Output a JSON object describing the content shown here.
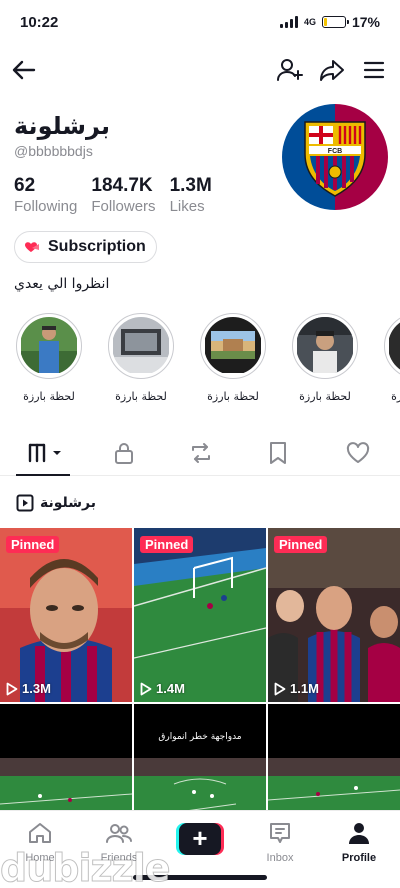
{
  "status_bar": {
    "time": "10:22",
    "network": "4G",
    "battery": "17%",
    "battery_level": 0.17
  },
  "nav": {
    "back_icon": "arrow-left-icon",
    "add_friend_icon": "add-user-icon",
    "share_icon": "share-icon",
    "menu_icon": "menu-icon"
  },
  "profile": {
    "name": "برشلونة",
    "handle": "@bbbbbbdjs",
    "stats": [
      {
        "value": "62",
        "label": "Following"
      },
      {
        "value": "184.7K",
        "label": "Followers"
      },
      {
        "value": "1.3M",
        "label": "Likes"
      }
    ],
    "subscription_label": "Subscription",
    "bio": "انظروا الي يعدي",
    "avatar_text": "FCB",
    "avatar_colors": [
      "#a50044",
      "#004d98",
      "#edbb00"
    ]
  },
  "highlights": [
    {
      "label": "لحظة بارزة"
    },
    {
      "label": "لحظة بارزة"
    },
    {
      "label": "لحظة بارزة"
    },
    {
      "label": "لحظة بارزة"
    },
    {
      "label": "لحظة بارزة"
    }
  ],
  "tabs": [
    "videos-grid-icon",
    "lock-icon",
    "repost-icon",
    "bookmark-icon",
    "heart-icon"
  ],
  "playlist": {
    "label": "برشلونة"
  },
  "videos": [
    {
      "pinned": "Pinned",
      "views": "1.3M"
    },
    {
      "pinned": "Pinned",
      "views": "1.4M"
    },
    {
      "pinned": "Pinned",
      "views": "1.1M"
    },
    {
      "pinned": "",
      "views": ""
    },
    {
      "pinned": "",
      "views": "",
      "caption": "مدواجهة خطر انموارق"
    },
    {
      "pinned": "",
      "views": ""
    }
  ],
  "bottom_nav": [
    {
      "label": "Home"
    },
    {
      "label": "Friends"
    },
    {
      "label": ""
    },
    {
      "label": "Inbox"
    },
    {
      "label": "Profile"
    }
  ],
  "watermark": "dubizzle",
  "colors": {
    "accent": "#fe2c55",
    "text": "#161823",
    "muted": "#8a8b91"
  }
}
